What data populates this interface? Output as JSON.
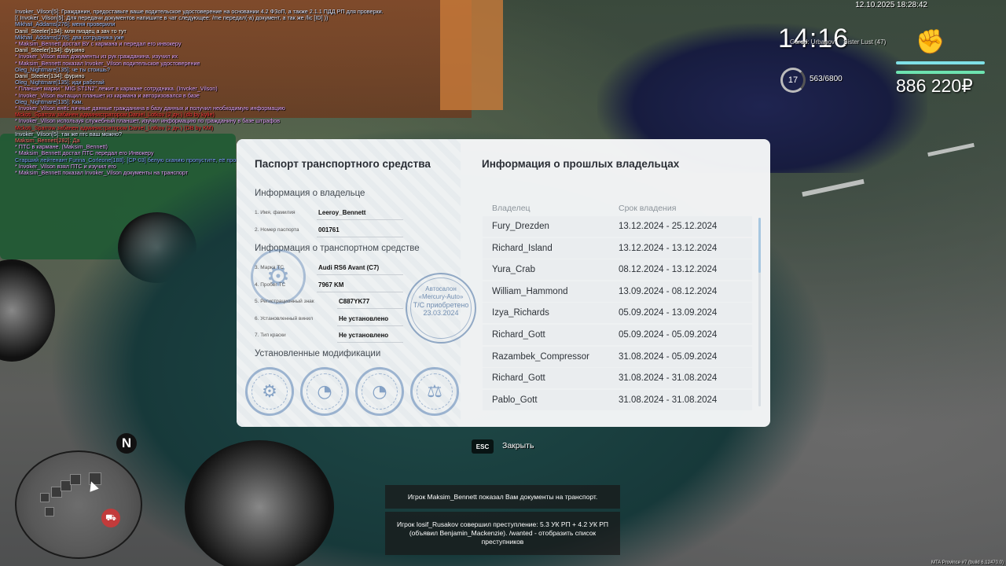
{
  "hud": {
    "datetime": "12.10.2025 18:28:42",
    "clock": "14:16",
    "zone_left": "Gorod: Urbanov",
    "zone_right": "Sister Lust (47)",
    "level": "17",
    "xp": "563/6800",
    "money": "886 220₽",
    "health_fraction": 1.0,
    "armor_fraction": 1.0,
    "icons": {
      "status": "fist-icon",
      "compass": "north-compass-icon"
    }
  },
  "chat": [
    {
      "text": "Invoker_Vilson[5]: Гражданин, предоставьте ваше водительское удостоверение на основании 4.2 ФЗоП, а также 2.1.1 ПДД РП для проверки.",
      "color": "#dfe7ff"
    },
    {
      "text": "[( Invoker_Vilson[5]: Для передачи документов напишите в чат следующее: /me передал(-а) документ, а так же /lic [ID] ))",
      "color": "#dfe7ff"
    },
    {
      "text": "Mikhail_Addams[276]: меня проверили",
      "color": "#a7c3ff"
    },
    {
      "text": "Danil_Steeler[134]: мля пиздец а зач то тут",
      "color": "#ffffff"
    },
    {
      "text": "Mikhail_Addams[276]: два сотрудника уже",
      "color": "#a7c3ff"
    },
    {
      "text": "* Maksim_Bennett достал ВУ с кармана и передал его инвокеру",
      "color": "#e7a8ff"
    },
    {
      "text": "Danil_Steeler[134]: фурино",
      "color": "#ffffff"
    },
    {
      "text": "* Invoker_Vilson взял документы из рук гражданина, изучил их",
      "color": "#e7a8ff"
    },
    {
      "text": "* Maksim_Bennett показал Invoker_Vilson водительское удостоверение",
      "color": "#e7a8ff"
    },
    {
      "text": "Oleg_Nightmare[135]: че ты стоишь?",
      "color": "#a7c3ff"
    },
    {
      "text": "Danil_Steeler[134]: фурино",
      "color": "#ffffff"
    },
    {
      "text": "Oleg_Nightmare[135]: иди работай",
      "color": "#a7c3ff"
    },
    {
      "text": "* Планшет марки \" MIG ST1N2\" лежит в кармане сотрудника. (Invoker_Vilson)",
      "color": "#e7a8ff"
    },
    {
      "text": "* Invoker_Vilson вытащил планшет из кармана и авторизовался в базе",
      "color": "#e7a8ff"
    },
    {
      "text": "Oleg_Nightmare[135]: Ккм.",
      "color": "#a7c3ff"
    },
    {
      "text": "* Invoker_Vilson внёс личные данные гражданина в базу данных и получил необходимую информацию",
      "color": "#e7a8ff"
    },
    {
      "text": "Mckoti_Sparrow забанен администратором Daniel_Lotkov (2 дн.) (db by kylie)",
      "color": "#ff3b3b"
    },
    {
      "text": "* Invoker_Vilson используя служебный планшет, изучил информацию по гражданину в базе штрафов",
      "color": "#e7a8ff"
    },
    {
      "text": "Mckoti_Sparrow забанен администратором Daniel_Lotkov (2 дн.) (DB by KM)",
      "color": "#ff3b3b"
    },
    {
      "text": "Invoker_Vilson[5]: так же птс ваш можно?",
      "color": "#dfe7ff"
    },
    {
      "text": "Maksim_Bennett[282]: Да",
      "color": "#ff6b6b"
    },
    {
      "text": "* ПТС в кармане. (Maksim_Bennett)",
      "color": "#e7a8ff"
    },
    {
      "text": "* Maksim_Bennett достал ПТС передал его Инвокеру",
      "color": "#e7a8ff"
    },
    {
      "text": "Старший лейтенант Furina_Corleone[188]: [СР-03] белую сканию пропустите, её проверяли.",
      "color": "#7fa4ff"
    },
    {
      "text": "* Invoker_Vilson взял ПТС и изучил его",
      "color": "#e7a8ff"
    },
    {
      "text": "* Maksim_Bennett показал Invoker_Vilson документы на транспорт",
      "color": "#e7a8ff"
    }
  ],
  "passport": {
    "title": "Паспорт транспортного средства",
    "owner_section": "Информация о владельце",
    "owner_fields": [
      {
        "label": "1. Имя, фамилия",
        "value": "Leeroy_Bennett"
      },
      {
        "label": "2. Номер паспорта",
        "value": "001761"
      }
    ],
    "vehicle_section": "Информация о транспортном средстве",
    "vehicle_fields": [
      {
        "label": "3. Марка ТС",
        "value": "Audi RS6 Avant (C7)"
      },
      {
        "label": "4. Пробег ТС",
        "value": "7967 KM"
      },
      {
        "label": "5. Регистрационный знак",
        "value": "C887YK77"
      },
      {
        "label": "6. Установленный винил",
        "value": "Не установлено"
      },
      {
        "label": "7. Тип краски",
        "value": "Не установлено"
      }
    ],
    "stamp": {
      "line1": "Автосалон",
      "line2": "«Mercury-Auto»",
      "line3": "Т/С приобретено",
      "line4": "23.03.2024"
    },
    "mods_section": "Установленные модификации",
    "mod_icons": [
      "base-mod-icon",
      "speed-mod-icon",
      "speed-mod-icon",
      "balance-mod-icon"
    ]
  },
  "history": {
    "title": "Информация о прошлых владельцах",
    "columns": [
      "Владелец",
      "Срок владения"
    ],
    "rows": [
      {
        "owner": "Fury_Drezden",
        "period": "13.12.2024 - 25.12.2024"
      },
      {
        "owner": "Richard_Island",
        "period": "13.12.2024 - 13.12.2024"
      },
      {
        "owner": "Yura_Crab",
        "period": "08.12.2024 - 13.12.2024"
      },
      {
        "owner": "William_Hammond",
        "period": "13.09.2024 - 08.12.2024"
      },
      {
        "owner": "Izya_Richards",
        "period": "05.09.2024 - 13.09.2024"
      },
      {
        "owner": "Richard_Gott",
        "period": "05.09.2024 - 05.09.2024"
      },
      {
        "owner": "Razambek_Compressor",
        "period": "31.08.2024 - 05.09.2024"
      },
      {
        "owner": "Richard_Gott",
        "period": "31.08.2024 - 31.08.2024"
      },
      {
        "owner": "Pablo_Gott",
        "period": "31.08.2024 - 31.08.2024"
      }
    ]
  },
  "close": {
    "key": "ESC",
    "label": "Закрыть"
  },
  "notifications": [
    "Игрок Maksim_Bennett показал Вам документы на транспорт.",
    "Игрок Iosif_Rusakov совершил преступление: 5.3 УК РП + 4.2 УК РП (объявил Benjamin_Mackenzie). /wanted - отобразить список преступников"
  ],
  "minimap": {
    "compass": "N"
  },
  "build": "MTA Province #7 (build 6.12470.0)"
}
